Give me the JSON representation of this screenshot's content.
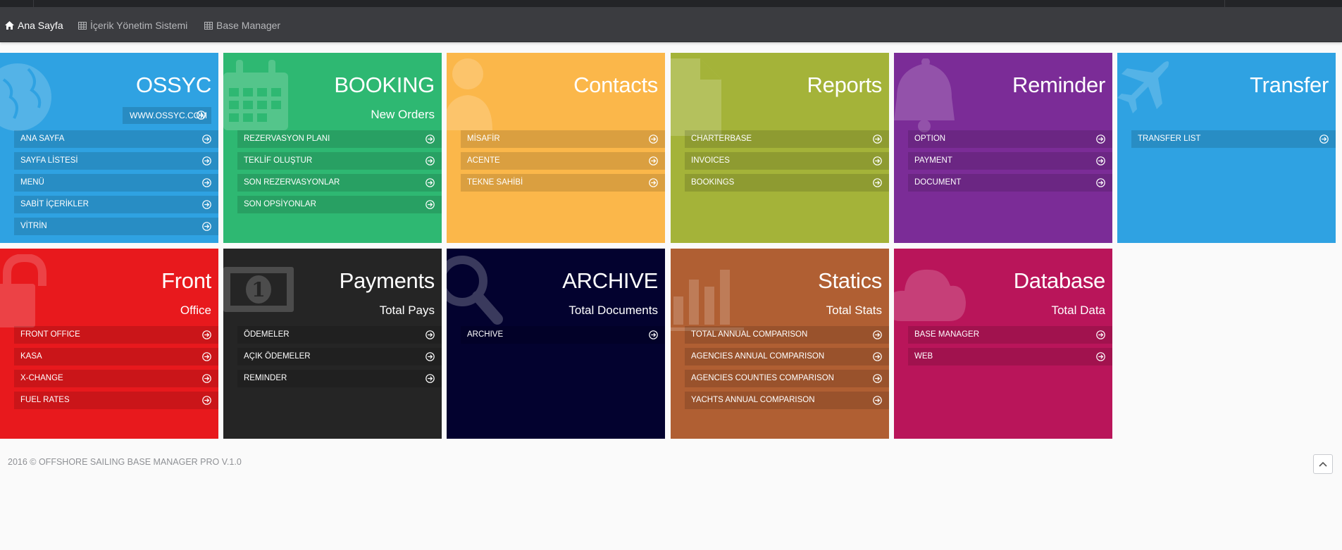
{
  "nav": {
    "items": [
      {
        "label": "Ana Sayfa",
        "icon": "home-icon",
        "active": true
      },
      {
        "label": "İçerik Yönetim Sistemi",
        "icon": "table-icon",
        "active": false
      },
      {
        "label": "Base Manager",
        "icon": "table-icon",
        "active": false
      }
    ]
  },
  "tiles": [
    {
      "id": "ossyc",
      "color": "#2fa2e2",
      "title": "OSSYC",
      "chip": "WWW.OSSYC.COM",
      "icon": "globe-icon",
      "items": [
        "ANA SAYFA",
        "SAYFA LİSTESİ",
        "MENÜ",
        "SABİT İÇERİKLER",
        "VİTRİN"
      ]
    },
    {
      "id": "booking",
      "color": "#2eb872",
      "title": "BOOKING",
      "subtitle": "New Orders",
      "icon": "calendar-icon",
      "items": [
        "REZERVASYON PLANI",
        "TEKLİF OLUŞTUR",
        "SON REZERVASYONLAR",
        "SON OPSİYONLAR"
      ]
    },
    {
      "id": "contacts",
      "color": "#fbb74a",
      "title": "Contacts",
      "icon": "user-icon",
      "items": [
        "MİSAFİR",
        "ACENTE",
        "TEKNE SAHİBİ"
      ]
    },
    {
      "id": "reports",
      "color": "#a4b339",
      "title": "Reports",
      "icon": "file-icon",
      "items": [
        "CHARTERBASE",
        "INVOICES",
        "BOOKINGS"
      ]
    },
    {
      "id": "reminder",
      "color": "#7b2c97",
      "title": "Reminder",
      "icon": "bell-icon",
      "items": [
        "OPTION",
        "PAYMENT",
        "DOCUMENT"
      ]
    },
    {
      "id": "transfer",
      "color": "#2fa2e2",
      "title": "Transfer",
      "icon": "plane-icon",
      "items": [
        "TRANSFER LIST"
      ]
    },
    {
      "id": "front",
      "color": "#e8191d",
      "title": "Front",
      "subtitle": "Office",
      "icon": "lock-icon",
      "items": [
        "FRONT OFFICE",
        "KASA",
        "X-CHANGE",
        "FUEL RATES"
      ]
    },
    {
      "id": "payments",
      "color": "#252525",
      "title": "Payments",
      "subtitle": "Total Pays",
      "icon": "money-icon",
      "items": [
        "ÖDEMELER",
        "AÇIK ÖDEMELER",
        "REMINDER"
      ]
    },
    {
      "id": "archive",
      "color": "#03022f",
      "title": "ARCHIVE",
      "subtitle": "Total Documents",
      "icon": "search-icon",
      "items": [
        "ARCHIVE"
      ]
    },
    {
      "id": "statics",
      "color": "#b05f33",
      "title": "Statics",
      "subtitle": "Total Stats",
      "icon": "bar-chart-icon",
      "items": [
        "TOTAL ANNUAL COMPARISON",
        "AGENCIES ANNUAL COMPARISON",
        "AGENCIES COUNTIES COMPARISON",
        "YACHTS ANNUAL COMPARISON"
      ]
    },
    {
      "id": "database",
      "color": "#b9155a",
      "title": "Database",
      "subtitle": "Total Data",
      "icon": "cloud-icon",
      "items": [
        "BASE MANAGER",
        "WEB"
      ]
    }
  ],
  "footer": {
    "text": "2016 © OFFSHORE SAILING BASE MANAGER PRO V.1.0"
  },
  "scroll_top": {
    "icon": "chevron-up-icon"
  }
}
